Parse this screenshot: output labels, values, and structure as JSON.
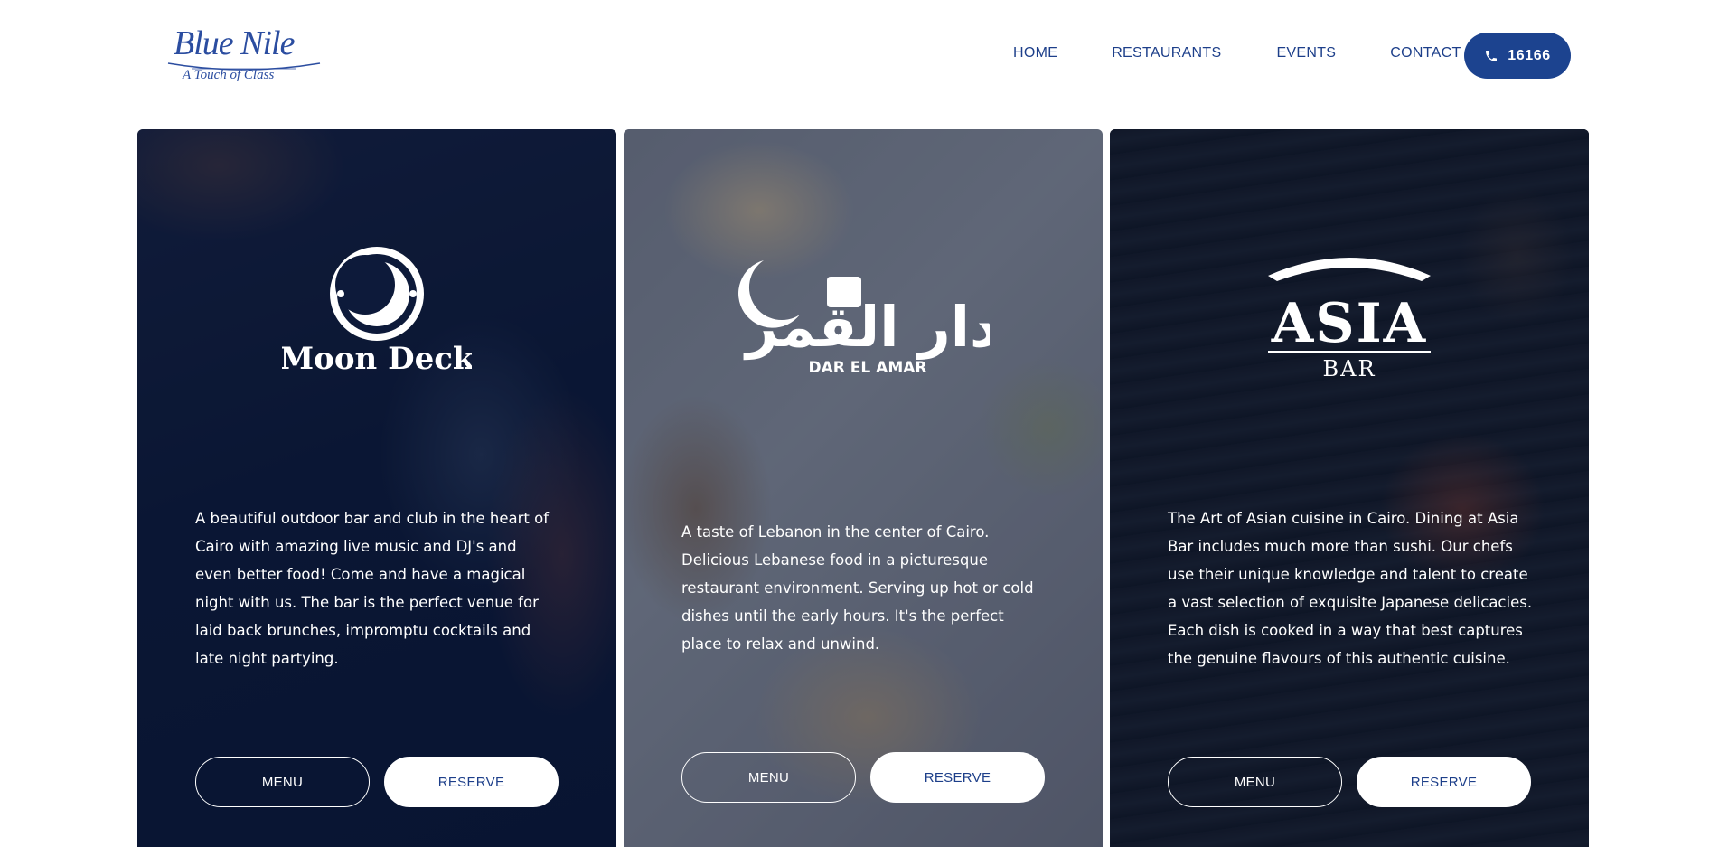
{
  "header": {
    "logo": {
      "name": "Blue Nile",
      "tagline": "A Touch of Class"
    },
    "nav": [
      {
        "label": "HOME"
      },
      {
        "label": "RESTAURANTS"
      },
      {
        "label": "EVENTS"
      },
      {
        "label": "CONTACT"
      }
    ],
    "phone": {
      "number": "16166",
      "icon": "phone-icon"
    }
  },
  "colors": {
    "brand": "#1c438f",
    "text": "#1d3f8a",
    "overlay": "#0b1a40"
  },
  "cards": [
    {
      "logo_text": "Moon Deck",
      "description": "A beautiful outdoor bar and club in the heart of Cairo with amazing live music and DJ's and even better food! Come and have a magical night with us. The bar is the perfect venue for laid back brunches, impromptu cocktails and late night partying.",
      "menu_label": "MENU",
      "reserve_label": "RESERVE"
    },
    {
      "logo_text_ar": "دار القمر",
      "logo_text": "DAR EL AMAR",
      "description": "A taste of Lebanon in the center of Cairo. Delicious Lebanese food in a picturesque restaurant environment. Serving up hot or cold dishes until the early hours. It's the perfect place to relax and unwind.",
      "menu_label": "MENU",
      "reserve_label": "RESERVE"
    },
    {
      "logo_text": "ASIA",
      "logo_subtext": "BAR",
      "description": "The Art of Asian cuisine in Cairo. Dining at Asia Bar includes much more than sushi. Our chefs use their unique knowledge and talent to create a vast selection of exquisite Japanese delicacies. Each dish is cooked in a way that best captures the genuine flavours of this authentic cuisine.",
      "menu_label": "MENU",
      "reserve_label": "RESERVE"
    }
  ]
}
